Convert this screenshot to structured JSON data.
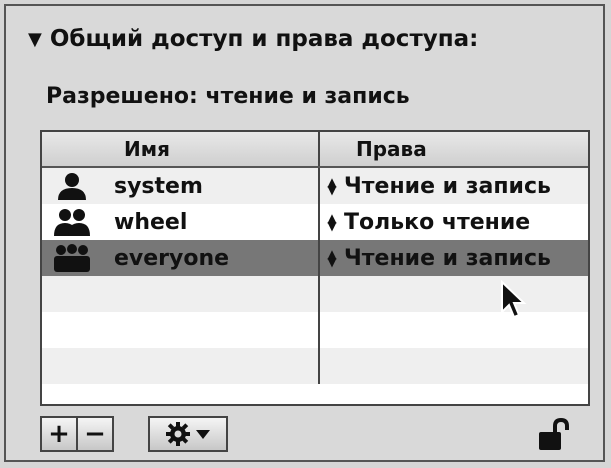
{
  "header": {
    "title": "Общий доступ и права доступа:"
  },
  "permission": {
    "text": "Разрешено: чтение и запись"
  },
  "table": {
    "columns": [
      "Имя",
      "Права"
    ],
    "rows": [
      {
        "name": "system",
        "rights": "Чтение и запись",
        "icon": "single-user-icon"
      },
      {
        "name": "wheel",
        "rights": "Только чтение",
        "icon": "group-icon"
      },
      {
        "name": "everyone",
        "rights": "Чтение и запись",
        "icon": "everyone-icon",
        "selected": true
      }
    ]
  },
  "toolbar": {
    "add_label": "+",
    "remove_label": "−"
  },
  "icons": {
    "action_menu": "gear-icon",
    "lock": "unlocked-lock-icon"
  }
}
